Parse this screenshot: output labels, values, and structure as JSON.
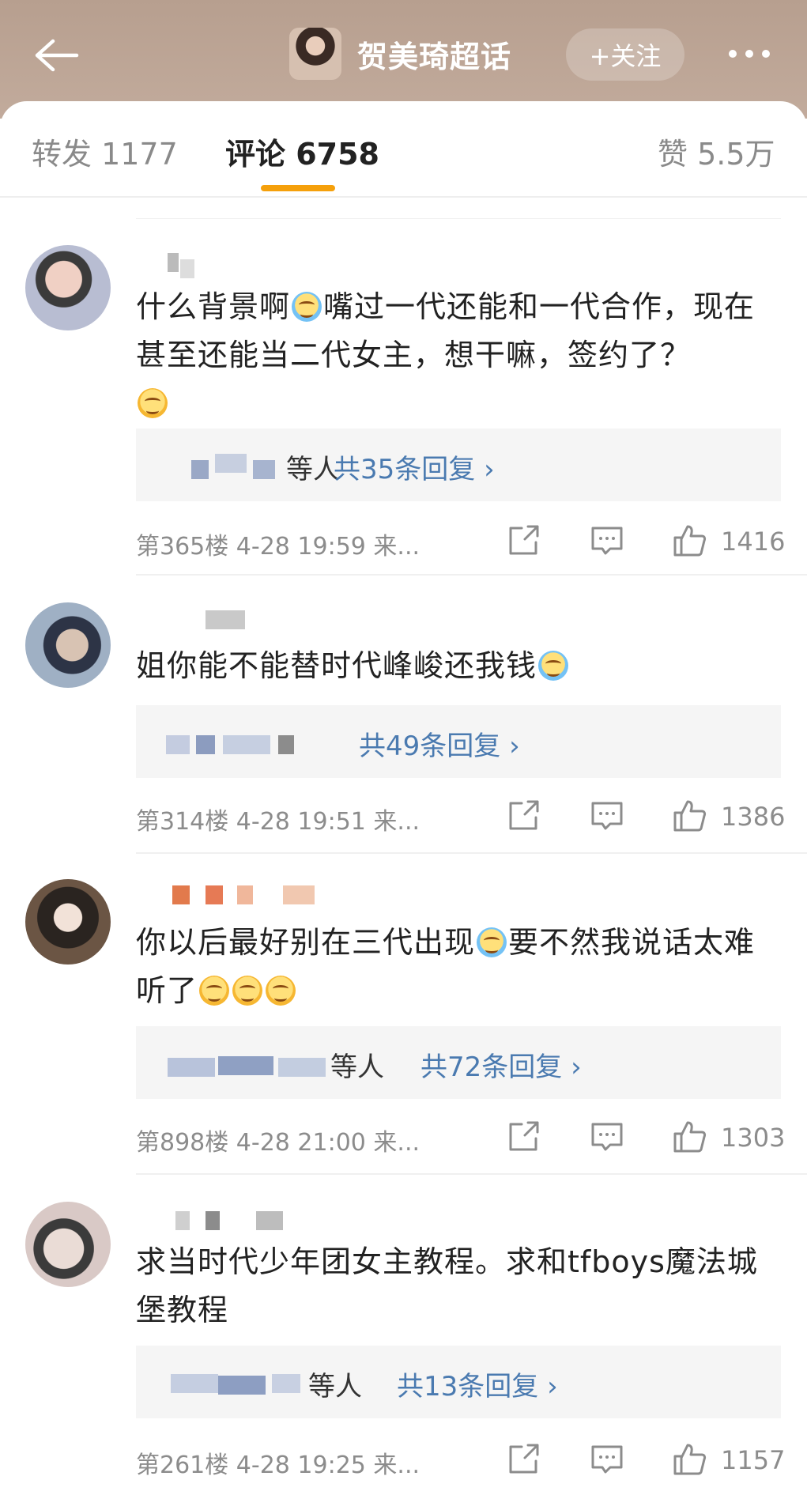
{
  "header": {
    "title": "贺美琦超话",
    "follow_label": "+关注"
  },
  "tabs": [
    {
      "label": "转发 1177"
    },
    {
      "label": "评论 6758"
    },
    {
      "label": "赞 5.5万"
    }
  ],
  "comments": [
    {
      "text_parts": [
        "什么背景啊",
        "嘴过一代还能和一代合作，现在甚至还能当二代女主，想干嘛，签约了？"
      ],
      "reply_suffix": "等人",
      "reply_count": "共35条回复 ›",
      "meta": "第365楼 4-28 19:59 来...",
      "likes": "1416"
    },
    {
      "text_parts": [
        "姐你能不能替时代峰峻还我钱"
      ],
      "reply_suffix": "",
      "reply_count": "共49条回复 ›",
      "meta": "第314楼 4-28 19:51 来...",
      "likes": "1386"
    },
    {
      "text_parts": [
        "你以后最好别在三代出现",
        "要不然我说话太难听了"
      ],
      "reply_suffix": "等人",
      "reply_count": "共72条回复 ›",
      "meta": "第898楼 4-28 21:00 来...",
      "likes": "1303"
    },
    {
      "text_parts": [
        "求当时代少年团女主教程。求和tfboys魔法城堡教程"
      ],
      "reply_suffix": "等人",
      "reply_count": "共13条回复 ›",
      "meta": "第261楼 4-28 19:25 来...",
      "likes": "1157"
    }
  ],
  "icons": {
    "back": "back-arrow-icon",
    "more": "more-dots-icon",
    "repost": "repost-icon",
    "comment": "comment-icon",
    "like": "thumbs-up-icon"
  },
  "colors": {
    "accent": "#f5a00b",
    "link": "#4a7ab0"
  }
}
